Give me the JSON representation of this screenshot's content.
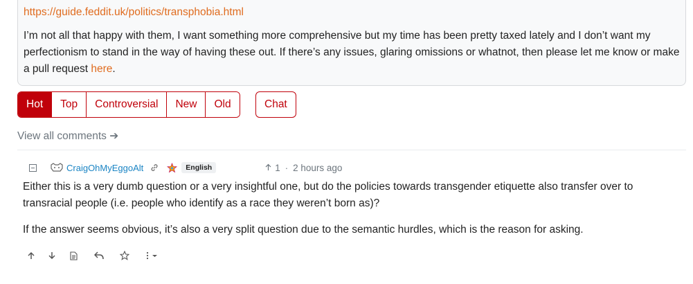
{
  "post": {
    "link_text": "https://guide.feddit.uk/politics/transphobia.html",
    "body_text": "I’m not all that happy with them, I want something more comprehensive but my time has been pretty taxed lately and I don’t want my perfectionism to stand in the way of having these out. If there’s any issues, glaring omissions or whatnot, then please let me know or make a pull request ",
    "body_link": "here",
    "body_end": "."
  },
  "sort": {
    "options": [
      "Hot",
      "Top",
      "Controversial",
      "New",
      "Old"
    ],
    "active": "Hot"
  },
  "chat_label": "Chat",
  "view_all_label": "View all comments ➔",
  "comment": {
    "username": "CraigOhMyEggoAlt",
    "language": "English",
    "score": "1",
    "separator": "·",
    "time": "2 hours ago",
    "paragraphs": [
      "Either this is a very dumb question or a very insightful one, but do the policies towards transgender etiquette also transfer over to transracial people (i.e. people who identify as a race they weren’t born as)?",
      "If the answer seems obvious, it’s also a very split question due to the semantic hurdles, which is the reason for asking."
    ]
  },
  "colors": {
    "accent": "#c0000a",
    "link": "#e06c1f",
    "username": "#1a84c4",
    "muted": "#6c757d"
  },
  "icons": {
    "collapse": "collapse-minus-icon",
    "avatar": "pixel-avatar-icon",
    "permalink": "link-icon",
    "community": "rainbow-star-icon",
    "upvote": "arrow-up-icon",
    "downvote": "arrow-down-icon",
    "source": "document-icon",
    "reply": "reply-icon",
    "save": "star-icon",
    "more": "more-vertical-icon"
  }
}
